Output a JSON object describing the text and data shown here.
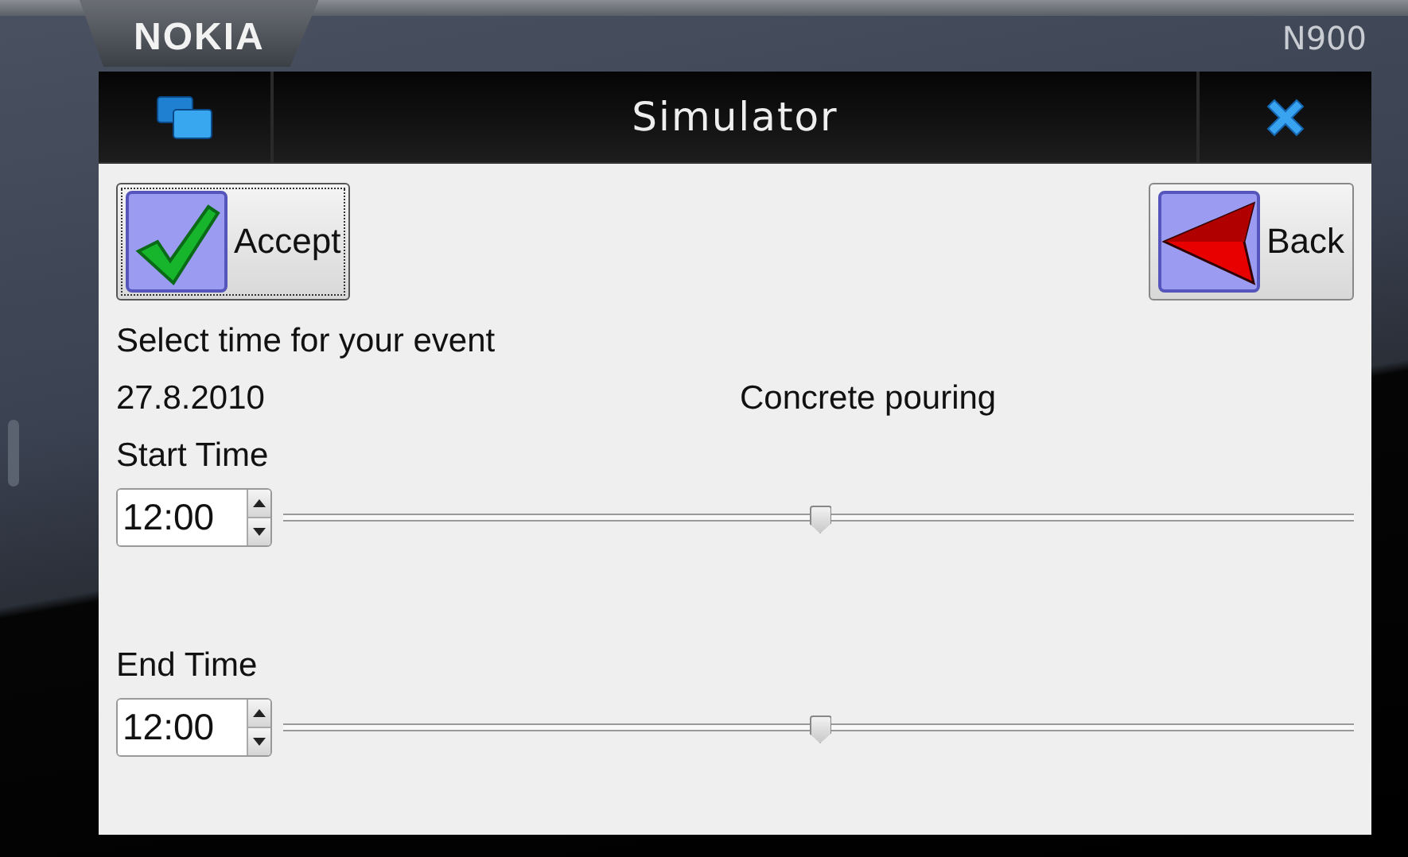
{
  "device": {
    "brand": "NOKIA",
    "model": "N900"
  },
  "window": {
    "title": "Simulator"
  },
  "buttons": [
    {
      "kind": "accept",
      "label": "Accept",
      "focused": true
    },
    {
      "kind": "back",
      "label": "Back",
      "focused": false
    }
  ],
  "prompt": "Select time for your event",
  "date": "27.8.2010",
  "event": "Concrete pouring",
  "times": [
    {
      "label": "Start Time",
      "value": "12:00",
      "level": 0.5
    },
    {
      "label": "End Time",
      "value": "12:00",
      "level": 0.5
    }
  ]
}
